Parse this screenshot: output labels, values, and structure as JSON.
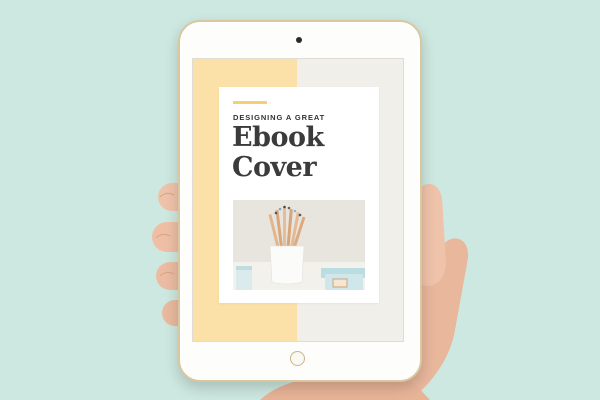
{
  "scene": {
    "background_color": "#cde8e0"
  },
  "tablet": {
    "frame_color": "#fdfdfb",
    "bezel_accent": "#d8c79f"
  },
  "ebook_cover": {
    "subtitle": "DESIGNING A GREAT",
    "title_line_1": "Ebook",
    "title_line_2": "Cover",
    "accent_color": "#f7cf77",
    "stripe_color": "#fbe1a7",
    "photo": {
      "description_icon": "pencil-cup-photo"
    }
  }
}
